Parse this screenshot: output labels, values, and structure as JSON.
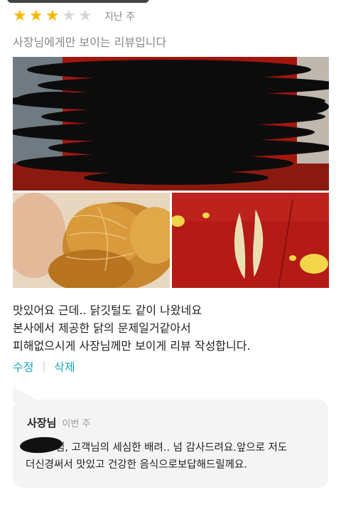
{
  "review": {
    "stars": [
      true,
      true,
      true,
      false,
      false
    ],
    "date": "지난 주",
    "owner_only_label": "사장님에게만 보이는 리뷰입니다",
    "text_lines": [
      "맛있어요 근데..  닭깃털도 같이 나왔네요",
      "본사에서 제공한 닭의 문제일거같아서",
      "피해없으시게 사장님께만 보이게 리뷰 작성합니다."
    ],
    "actions": {
      "edit": "수정",
      "delete": "삭제"
    }
  },
  "reply": {
    "author": "사장님",
    "when": "이번 주",
    "lines": [
      "님, 고객님의 세심한 배려.. 넘 감사드려요.앞으로 저도",
      "더신경써서 맛있고 건강한 음식으로보답해드릴께요."
    ]
  },
  "colors": {
    "accent": "#1ea6b8",
    "star_on": "#f5b800",
    "star_off": "#d6d6d6"
  }
}
